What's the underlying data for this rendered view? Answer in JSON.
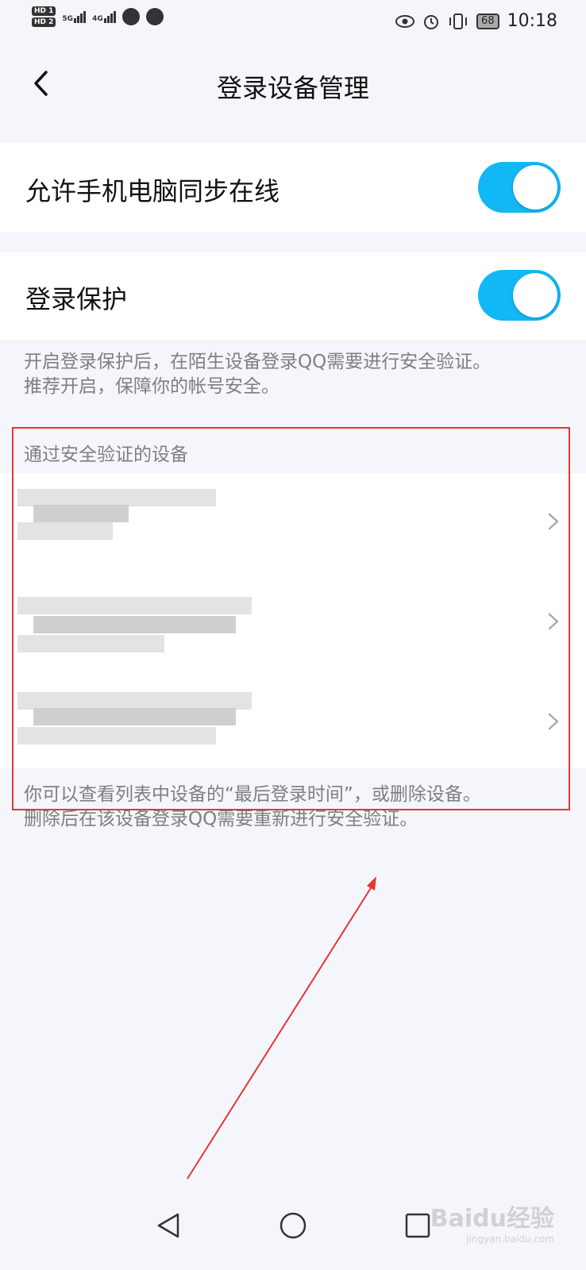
{
  "status_bar": {
    "hd1": "HD 1",
    "hd2": "HD 2",
    "net1": "5G",
    "net2": "4G",
    "battery": "68",
    "time": "10:18",
    "icons": [
      "wechat-icon",
      "location-icon",
      "eye-icon",
      "alarm-icon",
      "vibrate-icon"
    ]
  },
  "header": {
    "title": "登录设备管理"
  },
  "settings": {
    "sync_label": "允许手机电脑同步在线",
    "sync_on": true,
    "protect_label": "登录保护",
    "protect_on": true,
    "protect_hint_line1": "开启登录保护后，在陌生设备登录QQ需要进行安全验证。",
    "protect_hint_line2": "推荐开启，保障你的帐号安全。"
  },
  "devices": {
    "section_title": "通过安全验证的设备",
    "footer_line1": "你可以查看列表中设备的“最后登录时间”，或删除设备。",
    "footer_line2": "删除后在该设备登录QQ需要重新进行安全验证。"
  },
  "colors": {
    "toggle_on": "#12b7f5",
    "highlight": "#e63535"
  },
  "watermark": {
    "brand": "Baidu经验",
    "url": "jingyan.baidu.com"
  }
}
